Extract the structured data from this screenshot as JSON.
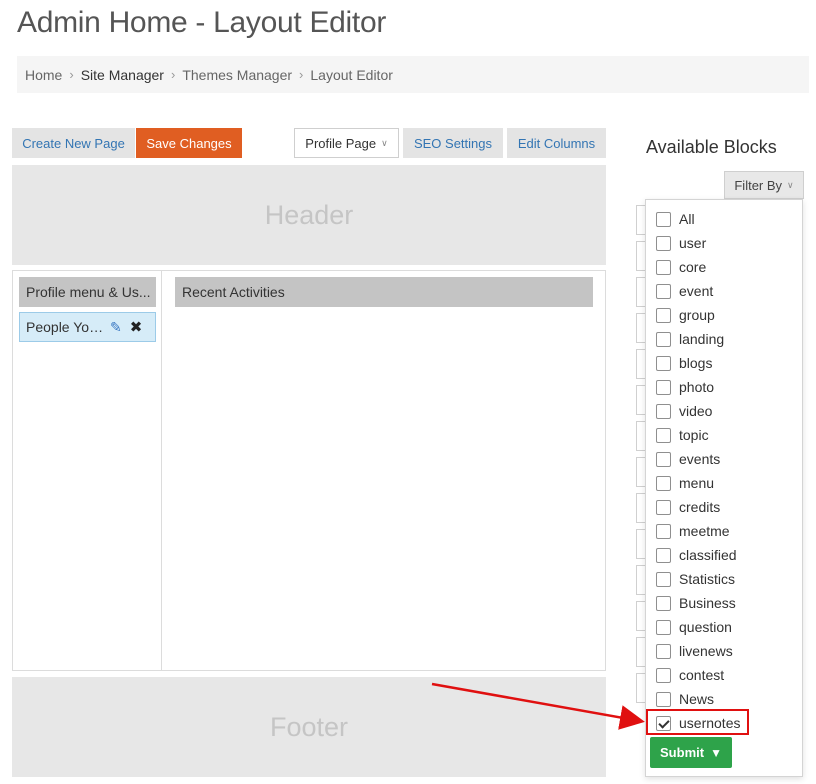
{
  "page": {
    "title": "Admin Home - Layout Editor"
  },
  "breadcrumb": {
    "items": [
      {
        "label": "Home"
      },
      {
        "label": "Site Manager"
      },
      {
        "label": "Themes Manager"
      },
      {
        "label": "Layout Editor"
      }
    ],
    "separator": "›"
  },
  "toolbar": {
    "create_new_page": "Create New Page",
    "save_changes": "Save Changes",
    "page_select": "Profile Page",
    "seo_settings": "SEO Settings",
    "edit_columns": "Edit Columns"
  },
  "layout": {
    "header_label": "Header",
    "footer_label": "Footer",
    "left_column": {
      "header": "Profile menu & Us...",
      "blocks": [
        {
          "label": "People You..."
        }
      ]
    },
    "main_column": {
      "header": "Recent Activities"
    }
  },
  "sidebar": {
    "title": "Available Blocks",
    "filter_button": "Filter By",
    "filter_options": [
      {
        "label": "All",
        "checked": false
      },
      {
        "label": "user",
        "checked": false
      },
      {
        "label": "core",
        "checked": false
      },
      {
        "label": "event",
        "checked": false
      },
      {
        "label": "group",
        "checked": false
      },
      {
        "label": "landing",
        "checked": false
      },
      {
        "label": "blogs",
        "checked": false
      },
      {
        "label": "photo",
        "checked": false
      },
      {
        "label": "video",
        "checked": false
      },
      {
        "label": "topic",
        "checked": false
      },
      {
        "label": "events",
        "checked": false
      },
      {
        "label": "menu",
        "checked": false
      },
      {
        "label": "credits",
        "checked": false
      },
      {
        "label": "meetme",
        "checked": false
      },
      {
        "label": "classified",
        "checked": false
      },
      {
        "label": "Statistics",
        "checked": false
      },
      {
        "label": "Business",
        "checked": false
      },
      {
        "label": "question",
        "checked": false
      },
      {
        "label": "livenews",
        "checked": false
      },
      {
        "label": "contest",
        "checked": false
      },
      {
        "label": "News",
        "checked": false
      },
      {
        "label": "usernotes",
        "checked": true
      }
    ],
    "submit_label": "Submit"
  },
  "colors": {
    "accent_orange": "#e05e22",
    "submit_green": "#2ea34a",
    "annotation_red": "#e01010",
    "link_blue": "#3375b3"
  }
}
